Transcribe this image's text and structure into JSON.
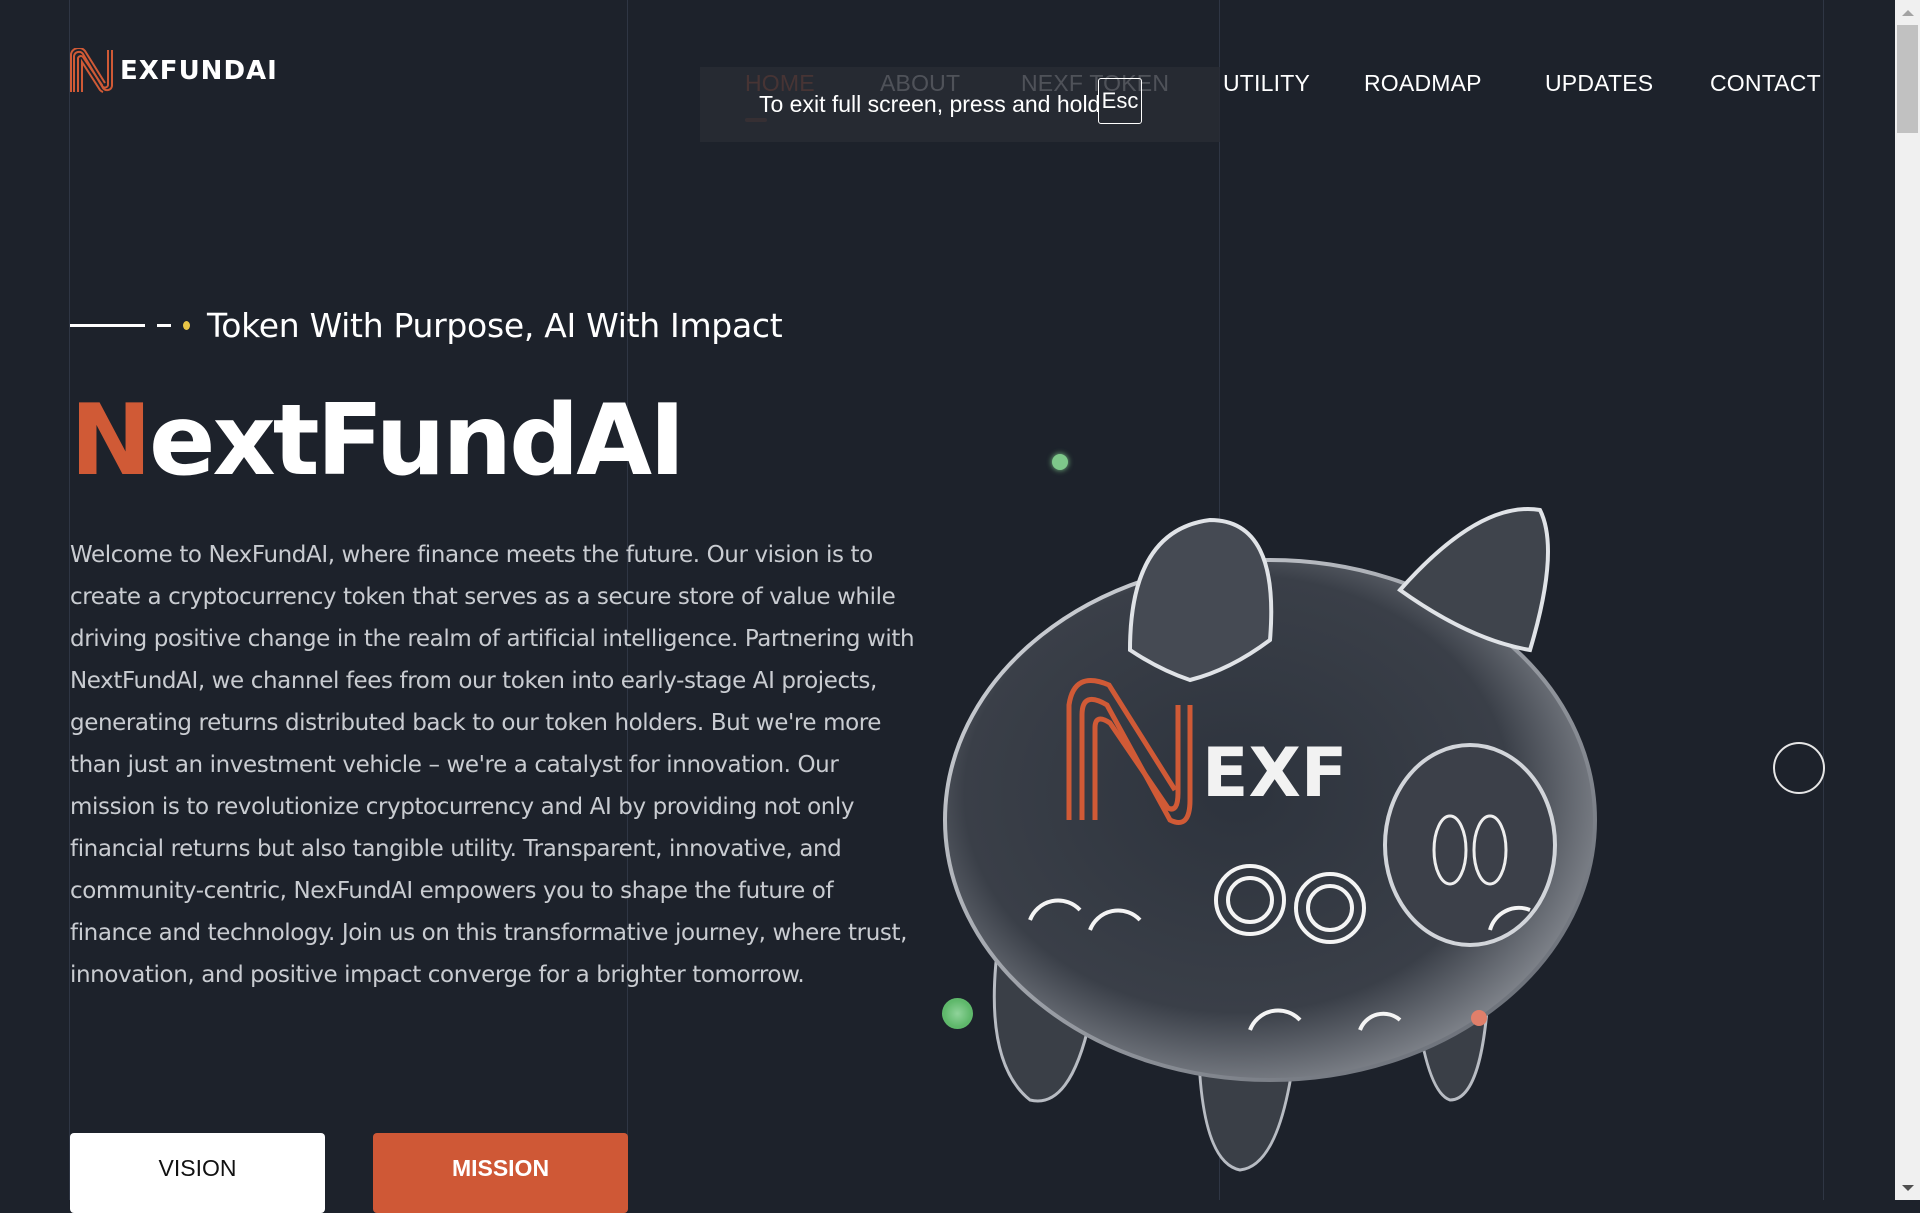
{
  "brand": {
    "logo_text": "EXFUNDAI",
    "accent_color": "#d05a36"
  },
  "nav": {
    "items": [
      {
        "label": "HOME",
        "active": true
      },
      {
        "label": "ABOUT"
      },
      {
        "label": "NEXF TOKEN"
      },
      {
        "label": "UTILITY"
      },
      {
        "label": "ROADMAP"
      },
      {
        "label": "UPDATES"
      },
      {
        "label": "CONTACT"
      }
    ]
  },
  "fullscreen_toast": {
    "message": "To exit full screen, press and hold",
    "key": "Esc"
  },
  "hero": {
    "tagline": "Token With Purpose, AI With Impact",
    "title_first_letter": "N",
    "title_rest": "extFundAI",
    "description": "Welcome to NexFundAI, where finance meets the future. Our vision is to create a cryptocurrency token that serves as a secure store of value while driving positive change in the realm of artificial intelligence. Partnering with NextFundAI, we channel fees from our token into early-stage AI projects, generating returns distributed back to our token holders. But we're more than just an investment vehicle – we're a catalyst for innovation. Our mission is to revolutionize cryptocurrency and AI by providing not only financial returns but also tangible utility. Transparent, innovative, and community-centric, NexFundAI empowers you to shape the future of finance and technology. Join us on this transformative journey, where trust, innovation, and positive impact converge for a brighter tomorrow.",
    "buttons": {
      "vision": "VISION",
      "mission": "MISSION"
    },
    "image_badge_text": "EXF"
  }
}
